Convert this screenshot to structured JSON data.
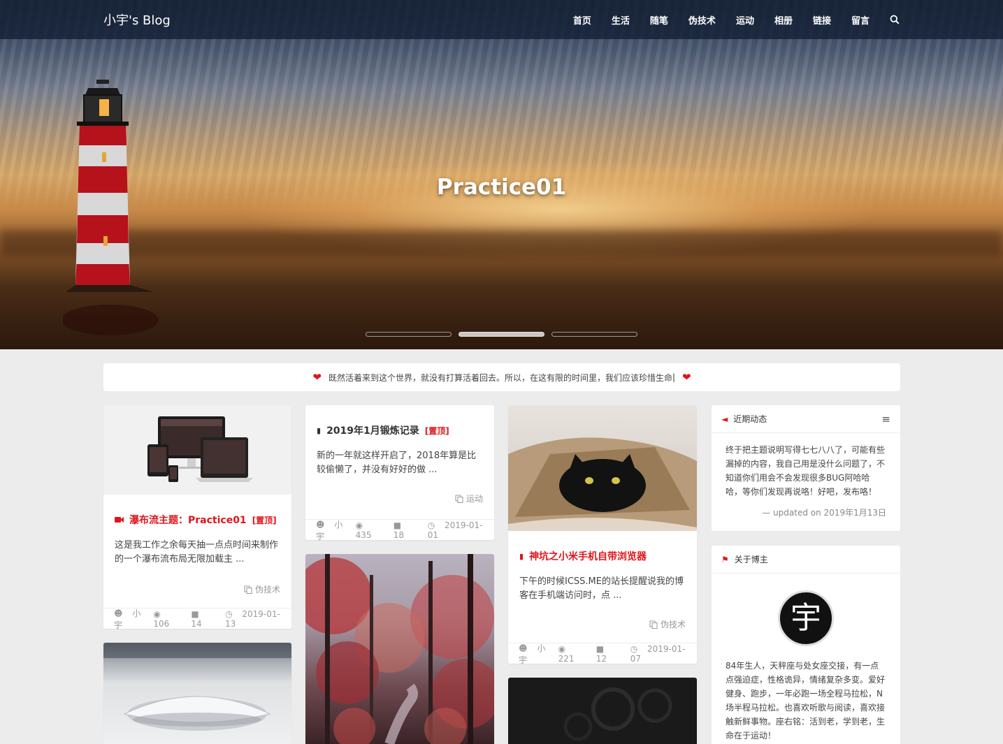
{
  "header": {
    "brand": "小宇's Blog",
    "nav": [
      {
        "label": "首页"
      },
      {
        "label": "生活"
      },
      {
        "label": "随笔"
      },
      {
        "label": "伪技术"
      },
      {
        "label": "运动"
      },
      {
        "label": "相册"
      },
      {
        "label": "链接"
      },
      {
        "label": "留言"
      }
    ],
    "search_icon": "search-icon"
  },
  "hero": {
    "title": "Practice01",
    "slides": 3,
    "active_slide": 2
  },
  "notice": {
    "text": "既然活着来到这个世界，就没有打算活着回去。所以，在这有限的时间里，我们应该珍惜生命",
    "icon": "heart-icon",
    "accent": "#e0161b"
  },
  "posts": {
    "p1": {
      "title": "瀑布流主题：Practice01",
      "pin": "[置顶]",
      "icon": "video-icon",
      "excerpt": "这是我工作之余每天抽一点点时间来制作的一个瀑布流布局无限加载主 ...",
      "category": "伪技术",
      "author": "小宇",
      "views": "106",
      "comments": "14",
      "date": "2019-01-13"
    },
    "p2": {
      "title": "2019年1月锻炼记录",
      "pin": "[置顶]",
      "icon": "book-icon",
      "excerpt": "新的一年就这样开启了，2018年算是比较偷懒了，并没有好好的做 ...",
      "category": "运动",
      "author": "小宇",
      "views": "435",
      "comments": "18",
      "date": "2019-01-01"
    },
    "p3": {
      "title": "神坑之小米手机自带浏览器",
      "icon": "book-icon",
      "excerpt": "下午的时候ICSS.ME的站长提醒说我的博客在手机端访问时，点 ...",
      "category": "伪技术",
      "author": "小宇",
      "views": "221",
      "comments": "12",
      "date": "2019-01-07"
    }
  },
  "sidebar": {
    "recent": {
      "title": "近期动态",
      "icon": "megaphone-icon",
      "text": "终于把主题说明写得七七八八了，可能有些漏掉的内容，我自己用是没什么问题了，不知道你们用会不会发现很多BUG阿哈哈哈，等你们发现再说咯！好吧，发布咯！",
      "updated": "— updated on 2019年1月13日"
    },
    "about": {
      "title": "关于博主",
      "icon": "bookmark-icon",
      "avatar_char": "宇",
      "text": "84年生人，天秤座与处女座交接，有一点点强迫症，性格诡异，情绪复杂多变。爱好健身、跑步，一年必跑一场全程马拉松，N场半程马拉松。也喜欢听歌与阅读，喜欢接触新鲜事物。座右铭：活到老，学到老，生命在于运动！"
    }
  }
}
